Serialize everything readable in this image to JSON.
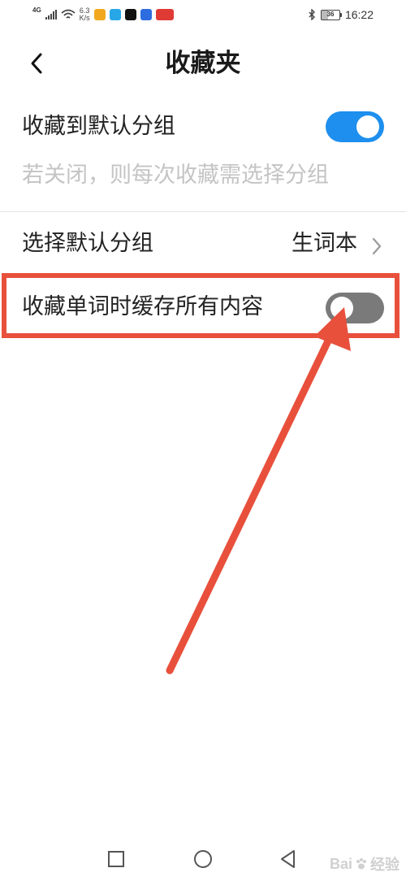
{
  "status_bar": {
    "network_type": "4G",
    "speed_value": "6.3",
    "speed_unit": "K/s",
    "battery_level": "36",
    "time": "16:22",
    "app_icons": [
      {
        "name": "58-icon",
        "color": "#f2a81e"
      },
      {
        "name": "browser-icon",
        "color": "#27a7e8"
      },
      {
        "name": "tiktok-icon",
        "color": "#111111"
      },
      {
        "name": "video-app-icon",
        "color": "#2d6de0"
      },
      {
        "name": "news-app-icon",
        "color": "#e03a35"
      }
    ]
  },
  "header": {
    "back_icon": "chevron-left-icon",
    "title": "收藏夹"
  },
  "settings": {
    "default_group_toggle": {
      "label": "收藏到默认分组",
      "state": "on",
      "hint": "若关闭，则每次收藏需选择分组"
    },
    "select_default_group": {
      "label": "选择默认分组",
      "value": "生词本",
      "icon": "chevron-right-icon"
    },
    "cache_content_toggle": {
      "label": "收藏单词时缓存所有内容",
      "state": "off"
    }
  },
  "colors": {
    "accent_blue": "#1e8fee",
    "toggle_off": "#7a7a7a",
    "annotation_red": "#e8503c",
    "hint_text": "#c4c4c4"
  },
  "nav_bar": {
    "icons": [
      "square-recents-icon",
      "circle-home-icon",
      "triangle-back-icon"
    ]
  },
  "watermark": {
    "text": "Bai",
    "suffix": "经验"
  }
}
